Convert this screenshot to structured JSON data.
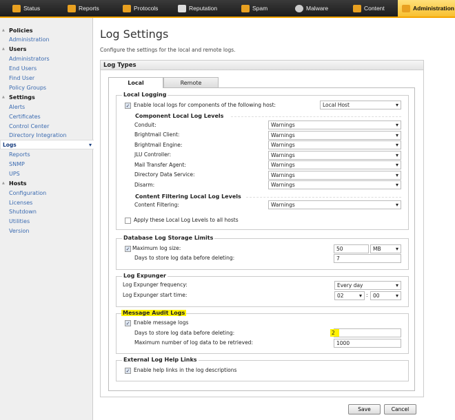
{
  "nav": {
    "items": [
      {
        "label": "Status"
      },
      {
        "label": "Reports"
      },
      {
        "label": "Protocols"
      },
      {
        "label": "Reputation"
      },
      {
        "label": "Spam"
      },
      {
        "label": "Malware"
      },
      {
        "label": "Content"
      },
      {
        "label": "Administration"
      }
    ],
    "active": "Administration",
    "accent": "#f5a400"
  },
  "sidebar": {
    "items": [
      "Policies",
      "Administration",
      "Users",
      "Administrators",
      "End Users",
      "Find User",
      "Policy Groups",
      "Settings",
      "Alerts",
      "Certificates",
      "Control Center",
      "Directory Integration",
      "Logs",
      "Reports",
      "SNMP",
      "UPS",
      "Hosts",
      "Configuration",
      "Licenses",
      "Shutdown",
      "Utilities",
      "Version"
    ]
  },
  "page": {
    "title": "Log Settings",
    "subtitle": "Configure the settings for the local and remote logs."
  },
  "panel": {
    "title": "Log Types",
    "tabs": [
      "Local",
      "Remote"
    ]
  },
  "local_logging": {
    "legend": "Local Logging",
    "enable_label": "Enable local logs for components of the following host:",
    "host": "Local Host",
    "component_header": "Component Local Log Levels",
    "components": [
      {
        "label": "Conduit:",
        "value": "Warnings"
      },
      {
        "label": "Brightmail Client:",
        "value": "Warnings"
      },
      {
        "label": "Brightmail Engine:",
        "value": "Warnings"
      },
      {
        "label": "JLU Controller:",
        "value": "Warnings"
      },
      {
        "label": "Mail Transfer Agent:",
        "value": "Warnings"
      },
      {
        "label": "Directory Data Service:",
        "value": "Warnings"
      },
      {
        "label": "Disarm:",
        "value": "Warnings"
      }
    ],
    "cf_header": "Content Filtering Local Log Levels",
    "cf_label": "Content Filtering:",
    "cf_value": "Warnings",
    "apply_label": "Apply these Local Log Levels to all hosts"
  },
  "db_limits": {
    "legend": "Database Log Storage Limits",
    "max_label": "Maximum log size:",
    "max_value": "50",
    "max_unit": "MB",
    "days_label": "Days to store log data before deleting:",
    "days_value": "7"
  },
  "expunger": {
    "legend": "Log Expunger",
    "freq_label": "Log Expunger frequency:",
    "freq_value": "Every day",
    "start_label": "Log Expunger start time:",
    "hour": "02",
    "sep": ":",
    "minute": "00"
  },
  "audit": {
    "legend": "Message Audit Logs",
    "enable_label": "Enable message logs",
    "days_label": "Days to store log data before deleting:",
    "days_value": "2",
    "max_label": "Maximum number of log data to be retrieved:",
    "max_value": "1000"
  },
  "help_links": {
    "legend": "External Log Help Links",
    "enable_label": "Enable help links in the log descriptions"
  },
  "buttons": {
    "save": "Save",
    "cancel": "Cancel"
  },
  "check": "✓"
}
